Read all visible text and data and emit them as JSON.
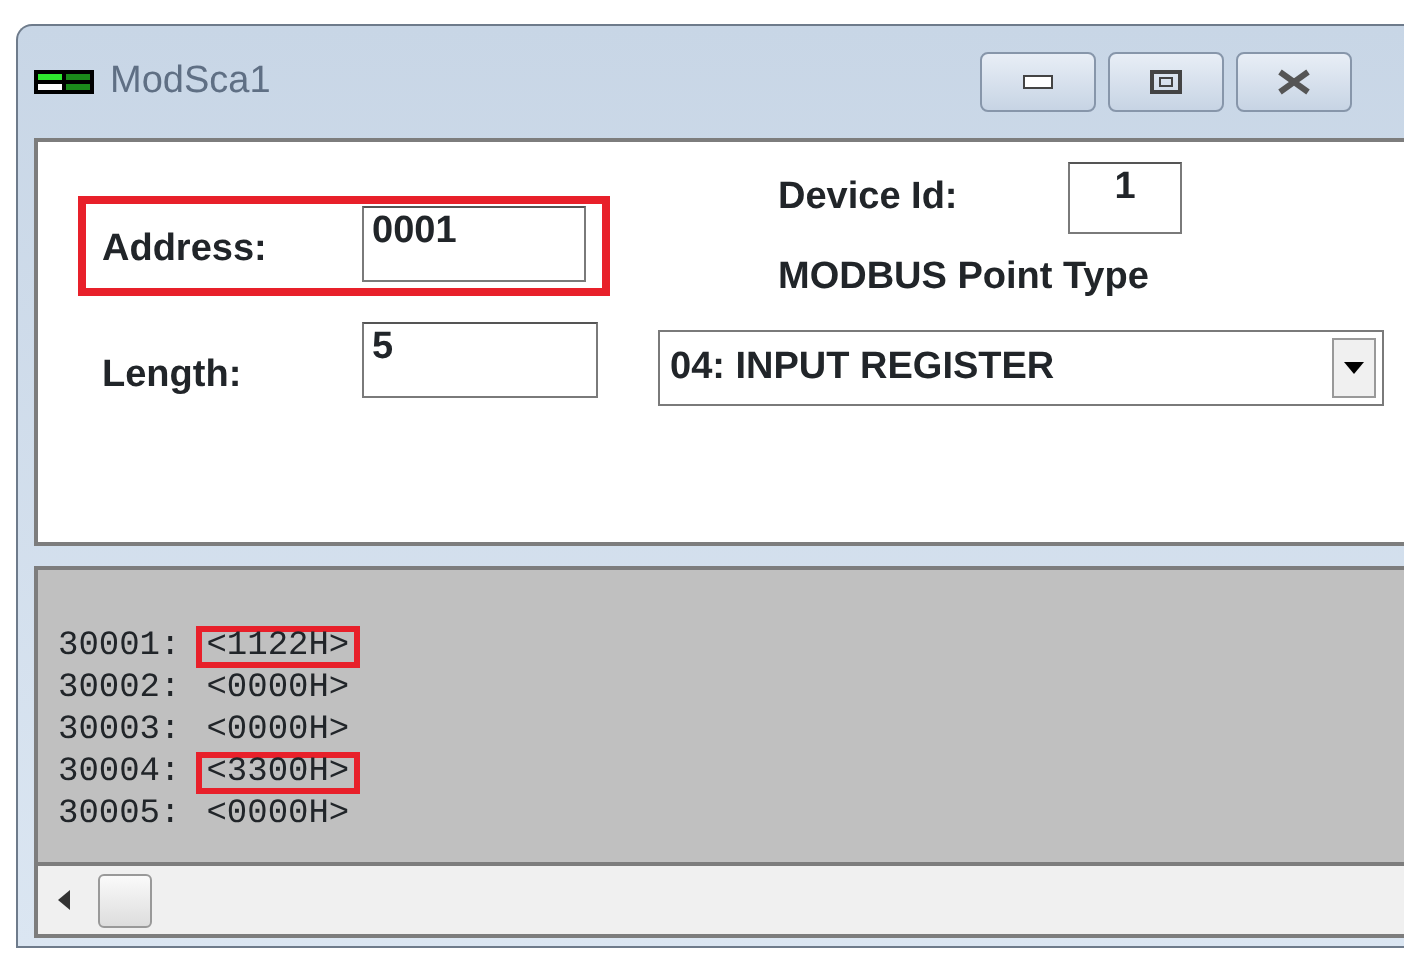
{
  "window": {
    "title": "ModSca1"
  },
  "form": {
    "address": {
      "label": "Address:",
      "value": "0001",
      "highlighted": true
    },
    "length": {
      "label": "Length:",
      "value": "5"
    },
    "device_id": {
      "label": "Device Id:",
      "value": "1"
    },
    "point_type": {
      "label": "MODBUS Point Type",
      "value": "04: INPUT REGISTER"
    }
  },
  "registers": [
    {
      "address": "30001:",
      "value": "<1122H>",
      "highlighted": true
    },
    {
      "address": "30002:",
      "value": "<0000H>",
      "highlighted": false
    },
    {
      "address": "30003:",
      "value": "<0000H>",
      "highlighted": false
    },
    {
      "address": "30004:",
      "value": "<3300H>",
      "highlighted": true
    },
    {
      "address": "30005:",
      "value": "<0000H>",
      "highlighted": false
    }
  ]
}
